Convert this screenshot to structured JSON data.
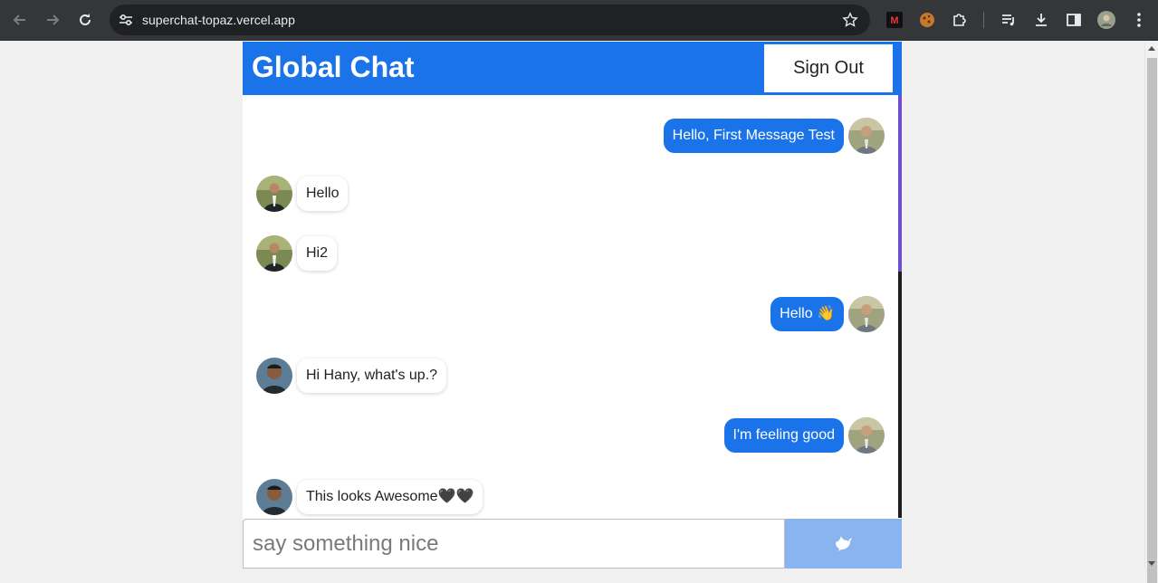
{
  "browser": {
    "url": "superchat-topaz.vercel.app"
  },
  "app": {
    "title": "Global Chat",
    "sign_out_label": "Sign Out"
  },
  "messages": [
    {
      "direction": "sent",
      "text": "Hello, First Message Test",
      "avatar": "user-photo-1"
    },
    {
      "direction": "received",
      "text": "Hello",
      "avatar": "user-photo-1"
    },
    {
      "direction": "received",
      "text": "Hi2",
      "avatar": "user-photo-1"
    },
    {
      "direction": "sent",
      "text": "Hello 👋",
      "avatar": "user-photo-1"
    },
    {
      "direction": "received",
      "text": "Hi Hany, what's up.?",
      "avatar": "user-photo-2"
    },
    {
      "direction": "sent",
      "text": "I'm feeling good",
      "avatar": "user-photo-1"
    },
    {
      "direction": "received",
      "text": "This looks Awesome🖤🖤",
      "avatar": "user-photo-2"
    }
  ],
  "composer": {
    "placeholder": "say something nice",
    "send_icon": "dove-icon"
  },
  "colors": {
    "accent": "#1a73e8",
    "send_button": "#8ab4f0",
    "chrome_bg": "#35363a"
  }
}
